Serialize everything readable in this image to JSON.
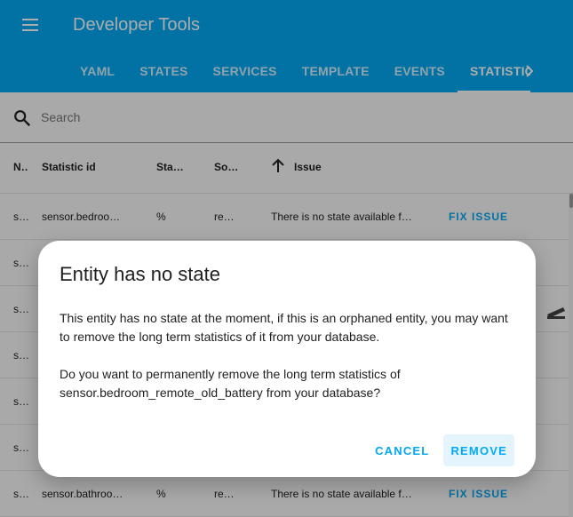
{
  "header": {
    "title": "Developer Tools",
    "tabs": [
      {
        "label": "YAML"
      },
      {
        "label": "STATES"
      },
      {
        "label": "SERVICES"
      },
      {
        "label": "TEMPLATE"
      },
      {
        "label": "EVENTS"
      },
      {
        "label": "STATISTICS",
        "active": true
      }
    ],
    "accent_color": "#03a9f4"
  },
  "search": {
    "placeholder": "Search",
    "value": ""
  },
  "table": {
    "columns": [
      "Name",
      "Statistic id",
      "Statistics unit",
      "Source",
      "Issue"
    ],
    "sorted_column": "Issue",
    "sort_direction": "ascending",
    "rows": [
      {
        "name": "sensor",
        "statistic_id": "sensor.bedroom_remote_old_battery",
        "unit": "%",
        "source": "recorder",
        "issue": "There is no state available for this entity",
        "action": "FIX ISSUE"
      },
      {
        "name": "sensor",
        "statistic_id": "",
        "unit": "",
        "source": "",
        "issue": "",
        "action": ""
      },
      {
        "name": "sensor",
        "statistic_id": "",
        "unit": "",
        "source": "",
        "issue": "",
        "action": ""
      },
      {
        "name": "sensor",
        "statistic_id": "",
        "unit": "",
        "source": "",
        "issue": "",
        "action": ""
      },
      {
        "name": "sensor",
        "statistic_id": "",
        "unit": "",
        "source": "",
        "issue": "",
        "action": ""
      },
      {
        "name": "sensor",
        "statistic_id": "",
        "unit": "",
        "source": "",
        "issue": "",
        "action": ""
      },
      {
        "name": "sensor",
        "statistic_id": "sensor.bathroom_battery",
        "unit": "%",
        "source": "recorder",
        "issue": "There is no state available for this entity",
        "action": "FIX ISSUE"
      }
    ]
  },
  "dialog": {
    "title": "Entity has no state",
    "paragraph1": "This entity has no state at the moment, if this is an orphaned entity, you may want to remove the long term statistics of it from your database.",
    "paragraph2": "Do you want to permanently remove the long term statistics of sensor.bedroom_remote_old_battery from your database?",
    "cancel_label": "CANCEL",
    "remove_label": "REMOVE"
  }
}
